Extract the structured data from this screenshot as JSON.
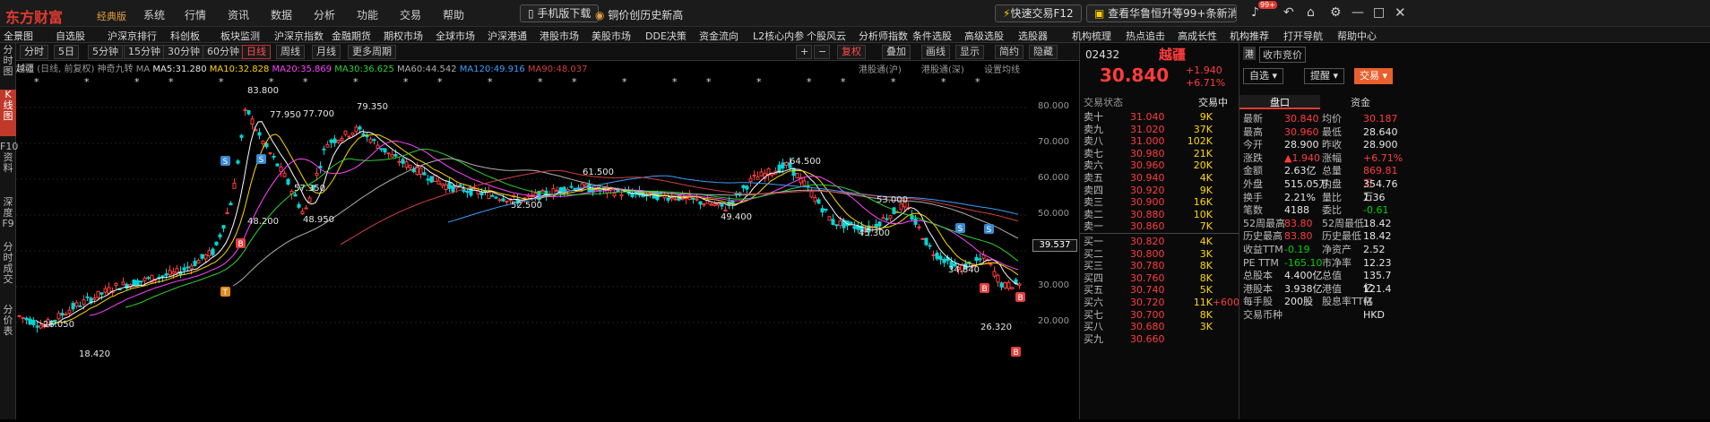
{
  "top": {
    "logo": "东方财富",
    "logo_sub": "经典版",
    "menu": [
      "系统",
      "行情",
      "资讯",
      "数据",
      "分析",
      "功能",
      "交易",
      "帮助"
    ],
    "mobile_download": "手机版下载",
    "news_headline": "铜价创历史新高",
    "fast_trade": "快速交易F12",
    "ticker_news": "查看华鲁恒升等99+条新消息",
    "badge": "99+"
  },
  "nav": [
    "全景图",
    "自选股",
    "沪深京排行",
    "科创板",
    "板块监测",
    "沪深京指数",
    "金融期货",
    "期权市场",
    "全球市场",
    "沪深港通",
    "港股市场",
    "美股市场",
    "DDE决策",
    "资金流向",
    "L2核心内参",
    "个股风云",
    "分析师指数",
    "条件选股",
    "高级选股",
    "选股器",
    "机构梳理",
    "热点追击",
    "高成长性",
    "机构推荐",
    "打开导航",
    "帮助中心"
  ],
  "left_tabs": [
    "分时图",
    "K线图",
    "F10资料",
    "深度F9",
    "分时成交",
    "分价表"
  ],
  "periods": [
    "分时",
    "5日",
    "5分钟",
    "15分钟",
    "30分钟",
    "60分钟",
    "日线",
    "周线",
    "月线",
    "更多周期"
  ],
  "tools": [
    "复权",
    "叠加",
    "画线",
    "显示",
    "简约",
    "隐藏"
  ],
  "ma": {
    "name": "越疆",
    "mode": "(日线, 前复权)",
    "indicator": "神奇九转",
    "ma5": "MA5:31.280",
    "ma10": "MA10:32.828",
    "ma20": "MA20:35.869",
    "ma30": "MA30:36.625",
    "ma60": "MA60:44.542",
    "ma120": "MA120:49.916",
    "ma90": "MA90:48.037",
    "hk1": "港股通(沪)",
    "hk2": "港股通(深)",
    "setting": "设置均线"
  },
  "chart_labels": {
    "peak": "83.800",
    "h1": "77.950",
    "h2": "77.700",
    "h3": "79.350",
    "h4": "64.500",
    "h5": "61.500",
    "h6": "57.350",
    "l1": "48.950",
    "l2": "48.200",
    "l3": "52.500",
    "l4": "49.400",
    "l5": "45.300",
    "l6": "34.840",
    "l7": "26.320",
    "l8": "26.050",
    "l9": "18.420",
    "h7": "53.000",
    "cur": "39.537"
  },
  "yaxis": [
    "80.000",
    "70.000",
    "60.000",
    "50.000",
    "40.000",
    "30.000",
    "20.000"
  ],
  "stock": {
    "code": "02432",
    "name": "越疆",
    "price": "30.840",
    "change": "+1.940",
    "pct": "+6.71%",
    "hk_tag": "港",
    "bid_note": "收市竞价",
    "status_label": "交易状态",
    "status": "交易中",
    "self_select": "自选",
    "remind": "提醒",
    "trade": "交易"
  },
  "sells": [
    {
      "label": "卖十",
      "price": "31.040",
      "vol": "9K"
    },
    {
      "label": "卖九",
      "price": "31.020",
      "vol": "37K"
    },
    {
      "label": "卖八",
      "price": "31.000",
      "vol": "102K"
    },
    {
      "label": "卖七",
      "price": "30.980",
      "vol": "21K"
    },
    {
      "label": "卖六",
      "price": "30.960",
      "price_note": "",
      "vol": "20K"
    },
    {
      "label": "卖五",
      "price": "30.940",
      "vol": "4K"
    },
    {
      "label": "卖四",
      "price": "30.920",
      "vol": "9K"
    },
    {
      "label": "卖三",
      "price": "30.900",
      "vol": "16K"
    },
    {
      "label": "卖二",
      "price": "30.880",
      "vol": "10K"
    },
    {
      "label": "卖一",
      "price": "30.860",
      "vol": "7K"
    }
  ],
  "buys": [
    {
      "label": "买一",
      "price": "30.820",
      "vol": "4K",
      "extra": ""
    },
    {
      "label": "买二",
      "price": "30.800",
      "vol": "3K",
      "extra": ""
    },
    {
      "label": "买三",
      "price": "30.780",
      "vol": "8K",
      "extra": ""
    },
    {
      "label": "买四",
      "price": "30.760",
      "vol": "8K",
      "extra": ""
    },
    {
      "label": "买五",
      "price": "30.740",
      "vol": "5K",
      "extra": ""
    },
    {
      "label": "买六",
      "price": "30.720",
      "vol": "11K",
      "extra": "+600"
    },
    {
      "label": "买七",
      "price": "30.700",
      "vol": "8K",
      "extra": ""
    },
    {
      "label": "买八",
      "price": "30.680",
      "vol": "3K",
      "extra": ""
    },
    {
      "label": "买九",
      "price": "30.660",
      "vol": "",
      "extra": ""
    }
  ],
  "quote_tabs": [
    "盘口",
    "资金"
  ],
  "quote": [
    [
      "最新",
      "30.840",
      "均价",
      "30.187"
    ],
    [
      "最高",
      "30.960",
      "最低",
      "28.640"
    ],
    [
      "今开",
      "28.900",
      "昨收",
      "28.900"
    ],
    [
      "涨跌",
      "▲1.940",
      "涨幅",
      "+6.71%"
    ],
    [
      "金额",
      "2.63亿",
      "总量",
      "869.81万"
    ],
    [
      "外盘",
      "515.05万",
      "内盘",
      "354.76万"
    ],
    [
      "换手",
      "2.21%",
      "量比",
      "1.36"
    ],
    [
      "笔数",
      "4188",
      "委比",
      "-0.61"
    ],
    [
      "52周最高",
      "83.80",
      "52周最低",
      "18.42"
    ],
    [
      "历史最高",
      "83.80",
      "历史最低",
      "18.42"
    ],
    [
      "收益TTM",
      "-0.19",
      "净资产",
      "2.52"
    ],
    [
      "PE TTM",
      "-165.10",
      "市净率",
      "12.23"
    ],
    [
      "总股本",
      "4.400亿",
      "总值",
      "135.7亿"
    ],
    [
      "港股本",
      "3.938亿",
      "港值",
      "121.4亿"
    ],
    [
      "每手股",
      "200股",
      "股息率TTM",
      "—"
    ],
    [
      "交易币种",
      "",
      "",
      "HKD"
    ]
  ],
  "colors": {
    "up": "#ff3c3c",
    "down": "#00d6d6",
    "ma5": "#ffffff",
    "ma10": "#ffd800",
    "ma20": "#ff44ff",
    "ma30": "#30d030",
    "ma60": "#b0b0b0",
    "ma120": "#3aa0ff",
    "ma90": "#d04040"
  }
}
